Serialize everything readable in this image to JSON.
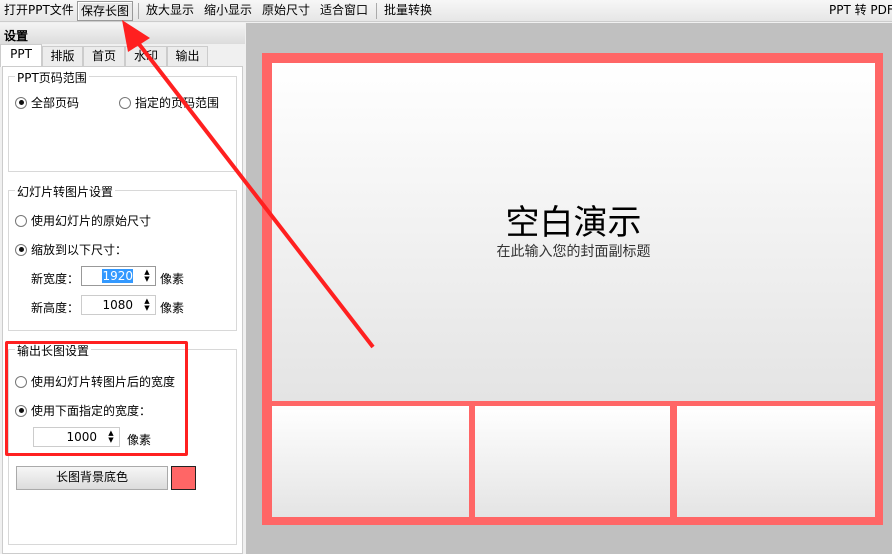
{
  "toolbar": {
    "open": "打开PPT文件",
    "save": "保存长图",
    "zoom_in": "放大显示",
    "zoom_out": "缩小显示",
    "original": "原始尺寸",
    "fit": "适合窗口",
    "batch": "批量转换",
    "right_title": "PPT 转 PDF"
  },
  "panel": {
    "title": "设置",
    "tabs": [
      "PPT",
      "排版",
      "首页",
      "水印",
      "输出"
    ]
  },
  "range": {
    "title": "PPT页码范围",
    "all": "全部页码",
    "specified": "指定的页码范围"
  },
  "convert": {
    "title": "幻灯片转图片设置",
    "original": "使用幻灯片的原始尺寸",
    "scale": "缩放到以下尺寸：",
    "width_label": "新宽度：",
    "width": "1920",
    "height_label": "新高度：",
    "height": "1080",
    "unit": "像素"
  },
  "output": {
    "title": "输出长图设置",
    "use_converted": "使用幻灯片转图片后的宽度",
    "use_specified": "使用下面指定的宽度：",
    "width": "1000",
    "unit": "像素",
    "bg_button": "长图背景底色",
    "bg_color": "#ff6666"
  },
  "slide": {
    "title": "空白演示",
    "subtitle": "在此输入您的封面副标题"
  },
  "colors": {
    "frame": "#ff6666",
    "annotation": "#ff2020"
  }
}
